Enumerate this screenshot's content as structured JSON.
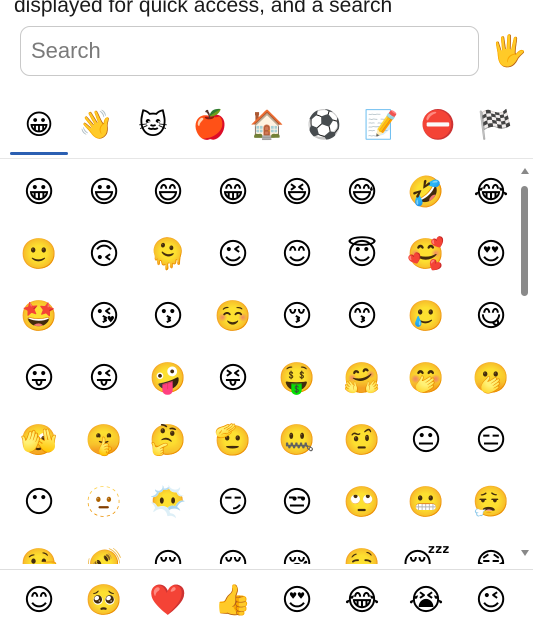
{
  "caption": "displayed for quick access, and a search",
  "search": {
    "placeholder": "Search",
    "value": ""
  },
  "skin_tone_button": "🖐",
  "tabs": [
    {
      "icon": "😀",
      "name": "smileys"
    },
    {
      "icon": "👋",
      "name": "people"
    },
    {
      "icon": "🐱",
      "name": "animals"
    },
    {
      "icon": "🍎",
      "name": "food"
    },
    {
      "icon": "🏠",
      "name": "travel"
    },
    {
      "icon": "⚽",
      "name": "activities"
    },
    {
      "icon": "📝",
      "name": "objects"
    },
    {
      "icon": "⛔",
      "name": "symbols"
    },
    {
      "icon": "🏁",
      "name": "flags"
    }
  ],
  "selected_tab": "smileys",
  "emoji_grid": [
    [
      "😀",
      "😃",
      "😄",
      "😁",
      "😆",
      "😅",
      "🤣",
      "😂"
    ],
    [
      "🙂",
      "🙃",
      "🫠",
      "😉",
      "😊",
      "😇",
      "🥰",
      "😍"
    ],
    [
      "🤩",
      "😘",
      "😗",
      "☺️",
      "😚",
      "😙",
      "🥲",
      "😋"
    ],
    [
      "😛",
      "😜",
      "🤪",
      "😝",
      "🤑",
      "🤗",
      "🤭",
      "🫢"
    ],
    [
      "🫣",
      "🤫",
      "🤔",
      "🫡",
      "🤐",
      "🤨",
      "😐",
      "😑"
    ],
    [
      "😶",
      "🫥",
      "😶‍🌫️",
      "😏",
      "😒",
      "🙄",
      "😬",
      "😮‍💨"
    ],
    [
      "🤥",
      "🫨",
      "😌",
      "😔",
      "😪",
      "🤤",
      "😴",
      "😷"
    ]
  ],
  "recent_emojis": [
    "😊",
    "🥺",
    "❤️",
    "👍",
    "😍",
    "😂",
    "😭",
    "😉"
  ]
}
